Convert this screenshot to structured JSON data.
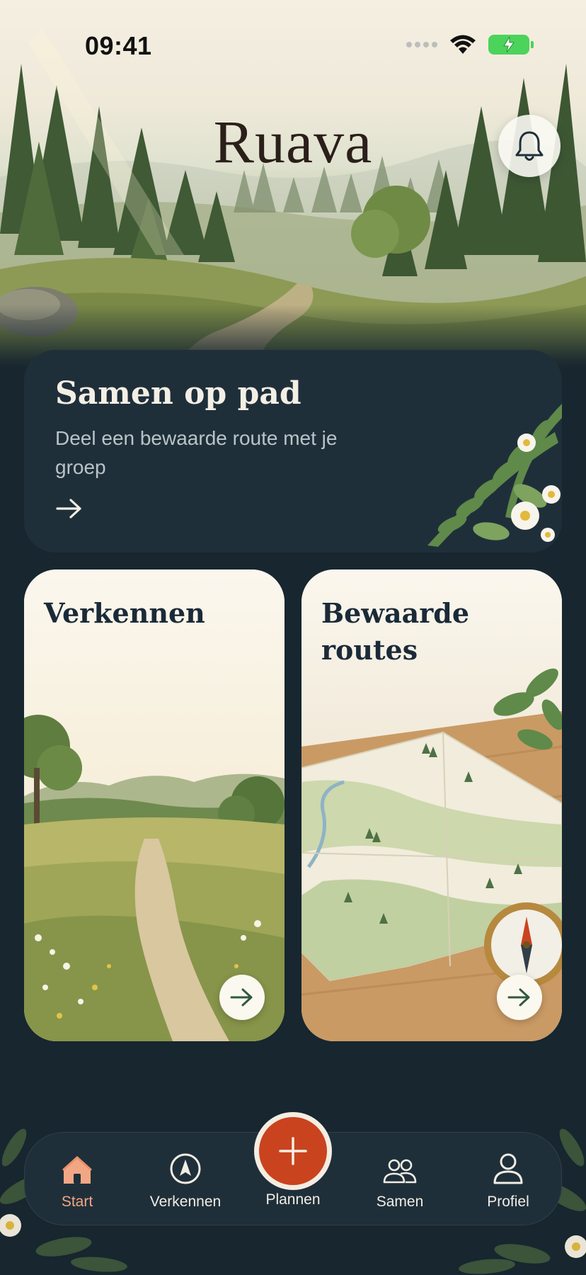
{
  "status_bar": {
    "time": "09:41"
  },
  "header": {
    "logo": "Ruava",
    "notification_icon": "bell-icon"
  },
  "promo_card": {
    "title": "Samen op pad",
    "description": "Deel een bewaarde route met je groep",
    "arrow_icon": "arrow-right-icon"
  },
  "tiles": [
    {
      "title": "Verkennen",
      "image": "meadow-path-illustration",
      "arrow_icon": "arrow-right-icon"
    },
    {
      "title": "Bewaarde routes",
      "image": "map-and-compass-illustration",
      "arrow_icon": "arrow-right-icon"
    }
  ],
  "tab_bar": {
    "items": [
      {
        "label": "Start",
        "icon": "home-icon",
        "active": true
      },
      {
        "label": "Verkennen",
        "icon": "compass-navigation-icon",
        "active": false
      },
      {
        "label": "Plannen",
        "icon": "plus-icon",
        "active": false
      },
      {
        "label": "Samen",
        "icon": "group-icon",
        "active": false
      },
      {
        "label": "Profiel",
        "icon": "user-icon",
        "active": false
      }
    ]
  },
  "colors": {
    "background": "#17262f",
    "card": "#1f2f3a",
    "accent": "#c9431f",
    "active_tab": "#f2a784",
    "tile_title": "#1b2a38"
  }
}
